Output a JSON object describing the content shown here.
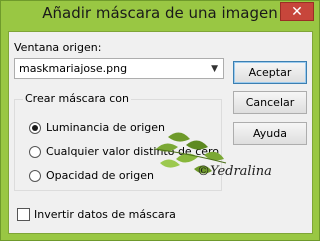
{
  "window": {
    "title": "Añadir máscara de una imagen",
    "close_label": "✕"
  },
  "source": {
    "label": "Ventana origen:",
    "value": "maskmariajose.png"
  },
  "buttons": {
    "ok": "Aceptar",
    "cancel": "Cancelar",
    "help": "Ayuda"
  },
  "group": {
    "title": "Crear máscara con",
    "options": [
      {
        "label": "Luminancia de origen",
        "selected": true
      },
      {
        "label": "Cualquier valor distinto de cero",
        "selected": false
      },
      {
        "label": "Opacidad de origen",
        "selected": false
      }
    ]
  },
  "invert": {
    "label": "Invertir datos de máscara",
    "checked": false
  },
  "watermark": "©Yedralina",
  "colors": {
    "frame": "#99c743",
    "close_button": "#c7463b",
    "dialog_bg": "#f0f0f0",
    "leaf": "#6e9a2a"
  }
}
